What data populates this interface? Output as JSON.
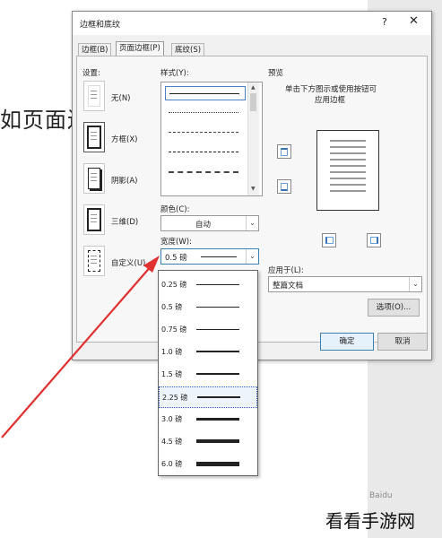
{
  "background": {
    "doc_text": "如页面边",
    "watermark": "看看手游网",
    "small_mark": "Baidu"
  },
  "dialog": {
    "title": "边框和底纹",
    "help": "?",
    "close": "✕",
    "tabs": [
      "边框(B)",
      "页面边框(P)",
      "底纹(S)"
    ],
    "active_tab": 1,
    "settings_label": "设置:",
    "settings": [
      {
        "label": "无(N)",
        "icon": "none-border-icon"
      },
      {
        "label": "方框(X)",
        "icon": "box-border-icon"
      },
      {
        "label": "阴影(A)",
        "icon": "shadow-border-icon"
      },
      {
        "label": "三维(D)",
        "icon": "3d-border-icon"
      },
      {
        "label": "自定义(U)",
        "icon": "custom-border-icon"
      }
    ],
    "style_label": "样式(Y):",
    "color_label": "颜色(C):",
    "color_value": "自动",
    "width_label": "宽度(W):",
    "width_value": "0.5 磅",
    "preview_label": "预览",
    "preview_hint_1": "单击下方图示或使用按钮可",
    "preview_hint_2": "应用边框",
    "apply_label": "应用于(L):",
    "apply_value": "整篇文档",
    "options_btn": "选项(O)...",
    "ok_btn": "确定",
    "cancel_btn": "取消"
  },
  "width_options": [
    {
      "label": "0.25 磅",
      "weight": 0.5
    },
    {
      "label": "0.5 磅",
      "weight": 1
    },
    {
      "label": "0.75 磅",
      "weight": 1
    },
    {
      "label": "1.0 磅",
      "weight": 1.2
    },
    {
      "label": "1.5 磅",
      "weight": 1.6
    },
    {
      "label": "2.25 磅",
      "weight": 2.2
    },
    {
      "label": "3.0 磅",
      "weight": 3
    },
    {
      "label": "4.5 磅",
      "weight": 4
    },
    {
      "label": "6.0 磅",
      "weight": 5
    }
  ],
  "selected_width_index": 5,
  "colors": {
    "arrow": "#e03030",
    "accent_border": "#3c7fb1"
  }
}
